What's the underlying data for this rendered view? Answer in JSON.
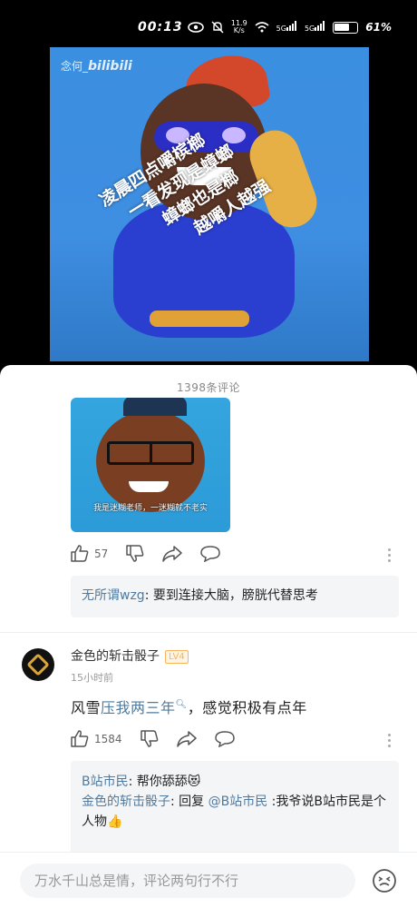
{
  "status_bar": {
    "time": "00:13",
    "network_speed": "11.9\nK/s",
    "signal_1": "5G",
    "signal_2": "5G",
    "battery": "61%"
  },
  "video": {
    "watermark_prefix": "念何_",
    "watermark_brand": "bilibili",
    "overlay_lines": [
      "凌晨四点嚼槟榔",
      "一看发现是蟑螂",
      "蟑螂也是榔",
      "越嚼人越强"
    ]
  },
  "comments": {
    "header": "1398条评论",
    "sticker_caption": "我是迷糊老师，一迷糊就不老实",
    "first": {
      "likes": "57",
      "reply_name": "无所谓wzg",
      "reply_text": ": 要到连接大脑，膀胱代替思考"
    },
    "second": {
      "username": "金色的斩击骰子",
      "level": "LV4",
      "time_ago": "15小时前",
      "text_prefix": "风雪",
      "text_keyword": "压我两三年",
      "text_suffix": "，感觉积极有点年",
      "likes": "1584",
      "replies": [
        {
          "name": "B站市民",
          "text": ": 帮你舔舔",
          "emoji": "😻"
        },
        {
          "name": "金色的斩击骰子",
          "text_mid": ": 回复 ",
          "mention": "@B站市民",
          "text": " :我爷说B站市民是个人物",
          "emoji": "👍"
        }
      ]
    }
  },
  "input": {
    "placeholder": "万水千山总是情，评论两句行不行"
  },
  "icons": {
    "like": "thumbs-up-icon",
    "dislike": "thumbs-down-icon",
    "share": "share-icon",
    "reply": "comment-bubble-icon",
    "more": "more-vertical-icon",
    "emoji": "emoji-face-icon"
  },
  "colors": {
    "link": "#4f7ba0",
    "background": "#ffffff",
    "video_bg": "#3b8fe0"
  }
}
